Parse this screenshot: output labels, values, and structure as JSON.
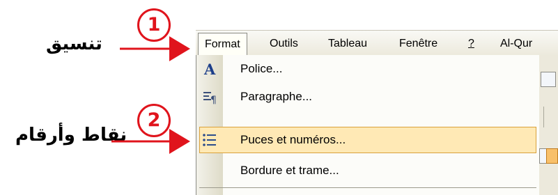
{
  "annotations": [
    {
      "number": "1",
      "label": "تنسيق"
    },
    {
      "number": "2",
      "label": "نقاط وأرقام"
    }
  ],
  "menubar": {
    "items": [
      {
        "label": "Format",
        "key": "t",
        "state": "open"
      },
      {
        "label": "Outils",
        "key": "O"
      },
      {
        "label": "Tableau",
        "key": "b"
      },
      {
        "label": "Fenêtre",
        "key": "ê"
      },
      {
        "label": "?",
        "key": "?"
      },
      {
        "label": "Al-Qur"
      }
    ]
  },
  "format_menu": {
    "items": [
      {
        "label": "Police...",
        "icon": "font-A-icon"
      },
      {
        "label": "Paragraphe...",
        "icon": "paragraph-icon"
      },
      {
        "label": "Puces et numéros...",
        "icon": "bullets-list-icon",
        "highlighted": true
      },
      {
        "label": "Bordure et trame...",
        "icon": ""
      }
    ]
  },
  "colors": {
    "annotation_red": "#e0141c",
    "highlight_fill": "#ffe9b5",
    "highlight_border": "#d9a13b",
    "menubar_bg": "#ece9dc"
  }
}
